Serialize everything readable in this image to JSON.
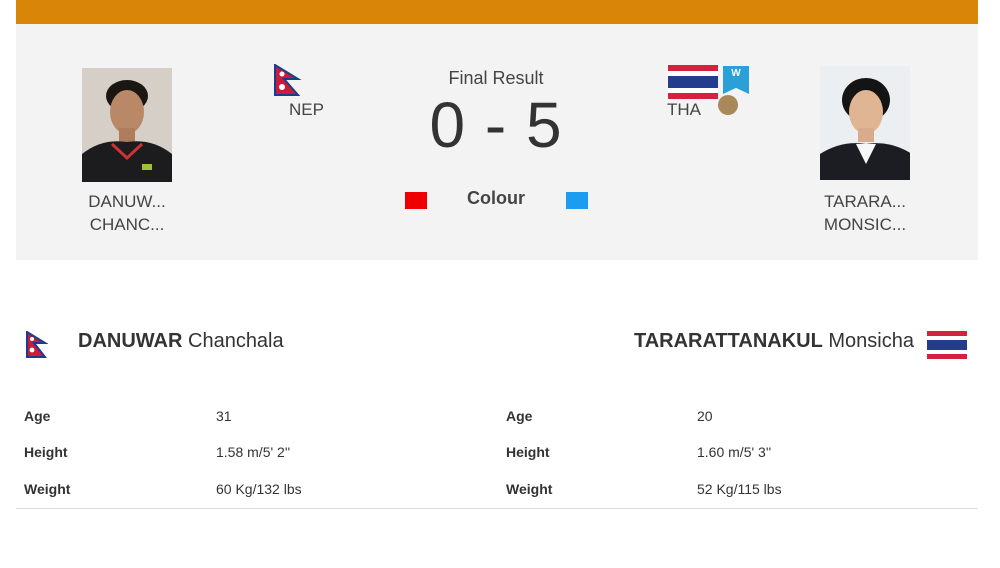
{
  "header": {
    "accent_color": "#d98608"
  },
  "result": {
    "label": "Final Result",
    "score": "0 - 5",
    "colour_label": "Colour",
    "red_color": "#ee0000",
    "blue_color": "#1a9cf0"
  },
  "left_athlete": {
    "short_line1": "DANUW...",
    "short_line2": "CHANC...",
    "country_code": "NEP",
    "surname": "DANUWAR",
    "given_name": "Chanchala",
    "flag_icon": "nepal-flag-icon",
    "stats": [
      {
        "label": "Age",
        "value": "31"
      },
      {
        "label": "Height",
        "value": "1.58 m/5' 2''"
      },
      {
        "label": "Weight",
        "value": "60 Kg/132 lbs"
      }
    ]
  },
  "right_athlete": {
    "short_line1": "TARARA...",
    "short_line2": "MONSIC...",
    "country_code": "THA",
    "surname": "TARARATTANAKUL",
    "given_name": "Monsicha",
    "flag_icon": "thailand-flag-icon",
    "badge": "W",
    "medal": "bronze-medal-icon",
    "stats": [
      {
        "label": "Age",
        "value": "20"
      },
      {
        "label": "Height",
        "value": "1.60 m/5' 3''"
      },
      {
        "label": "Weight",
        "value": "52 Kg/115 lbs"
      }
    ]
  }
}
